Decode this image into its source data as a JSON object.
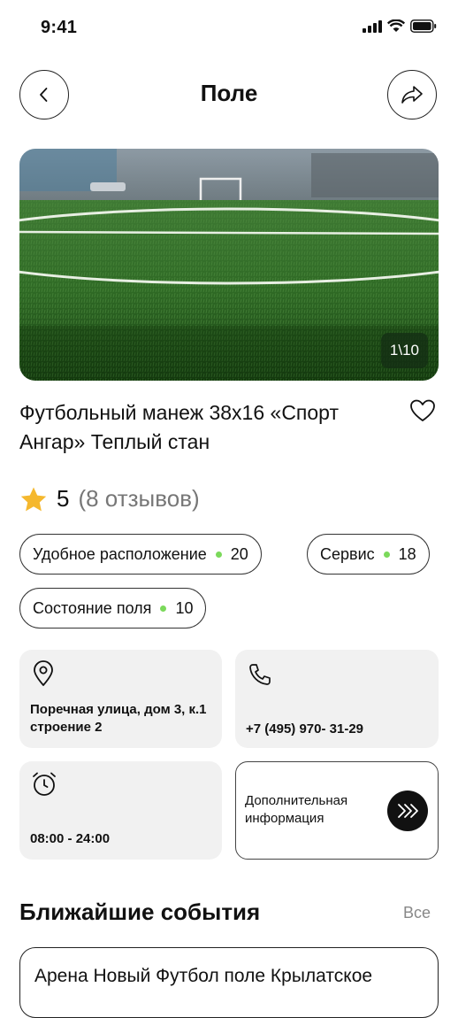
{
  "status_bar": {
    "time": "9:41"
  },
  "header": {
    "title": "Поле"
  },
  "gallery": {
    "counter": "1\\10"
  },
  "venue": {
    "title": "Футбольный манеж 38х16 «Спорт Ангар» Теплый стан"
  },
  "rating": {
    "score": "5",
    "reviews": "(8 отзывов)"
  },
  "tags": [
    {
      "label": "Удобное расположение",
      "count": "20"
    },
    {
      "label": "Сервис",
      "count": "18"
    },
    {
      "label": "Состояние поля",
      "count": "10"
    }
  ],
  "info": {
    "address": "Поречная улица, дом 3, к.1 строение 2",
    "phone": "+7 (495) 970- 31-29",
    "hours": "08:00 - 24:00",
    "more": "Дополнительная информация"
  },
  "events": {
    "title": "Ближайшие события",
    "all_label": "Все",
    "items": [
      {
        "title": "Арена Новый Футбол поле  Крылатское"
      }
    ]
  },
  "colors": {
    "accent_dot": "#7bd95b",
    "star": "#f5b82e",
    "dark": "#111111"
  }
}
